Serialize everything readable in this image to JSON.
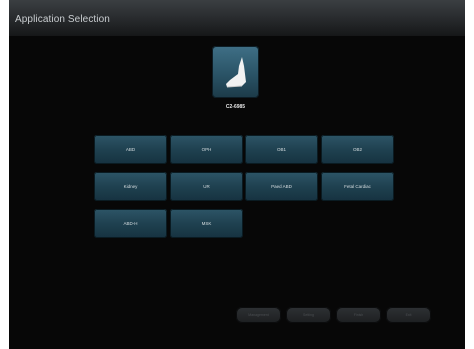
{
  "window": {
    "title": "Application Selection"
  },
  "probe": {
    "name": "C2-6985",
    "icon": "ultrasound-probe-icon"
  },
  "applications": [
    {
      "label": "ABD"
    },
    {
      "label": "OPH"
    },
    {
      "label": "OB1"
    },
    {
      "label": "OB2"
    },
    {
      "label": "Kidney"
    },
    {
      "label": "UR"
    },
    {
      "label": "Paed ABD"
    },
    {
      "label": "Fetal Cardiac"
    },
    {
      "label": "ABD-H"
    },
    {
      "label": "MSK"
    }
  ],
  "bottom_buttons": [
    {
      "label": "Management"
    },
    {
      "label": "Setting"
    },
    {
      "label": "Finish"
    },
    {
      "label": "Exit"
    }
  ],
  "colors": {
    "tile_accent": "#2a5366",
    "background": "#070707"
  }
}
